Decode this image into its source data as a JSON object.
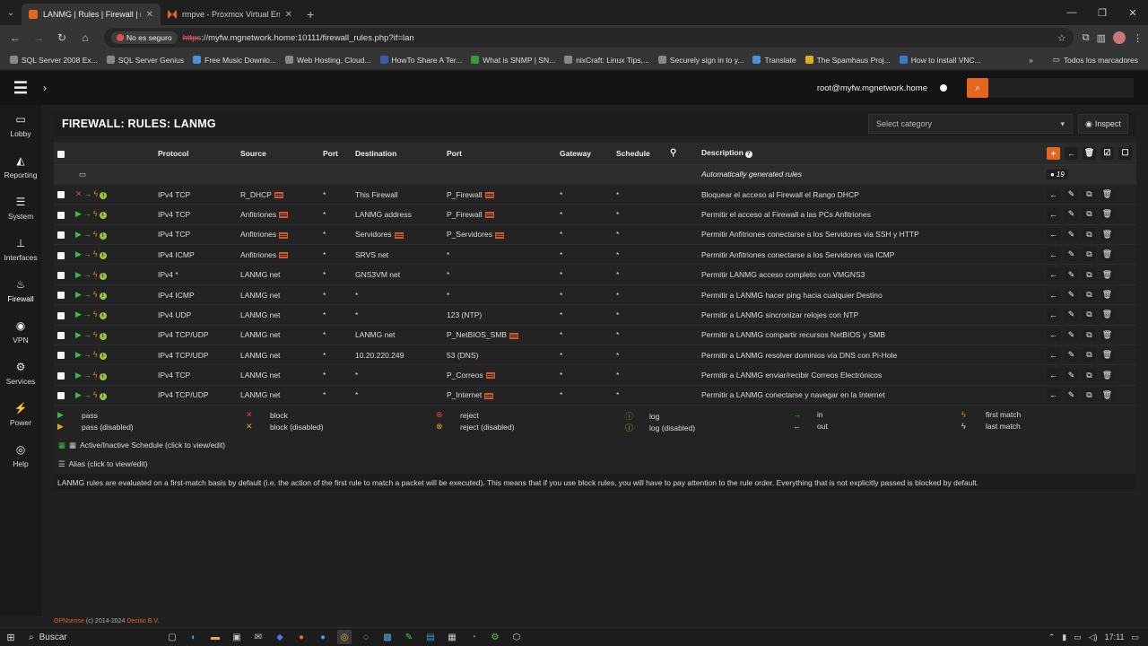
{
  "browser": {
    "tabs": [
      {
        "title": "LANMG | Rules | Firewall | myfw",
        "fav_color": "#e5661c",
        "active": true
      },
      {
        "title": "rmpve - Proxmox Virtual Enviro",
        "fav_color": "#e5661c",
        "active": false
      }
    ],
    "insecure_label": "No es seguro",
    "url_scheme": "https",
    "url_rest": "://myfw.mgnetwork.home:10111/firewall_rules.php?if=lan",
    "bookmarks": [
      "SQL Server 2008 Ex...",
      "SQL Server Genius",
      "Free Music Downlo...",
      "Web Hosting, Cloud...",
      "HowTo Share A Ter...",
      "What is SNMP | SN...",
      "nixCraft: Linux Tips,...",
      "Securely sign in to y...",
      "Translate",
      "The Spamhaus Proj...",
      "How to install VNC..."
    ],
    "all_bookmarks": "Todos los marcadores"
  },
  "header": {
    "user": "root@myfw.mgnetwork.home"
  },
  "nav": [
    {
      "label": "Lobby",
      "icon": "laptop-icon",
      "glyph": "▭"
    },
    {
      "label": "Reporting",
      "icon": "chart-icon",
      "glyph": "◭"
    },
    {
      "label": "System",
      "icon": "server-icon",
      "glyph": "☰"
    },
    {
      "label": "Interfaces",
      "icon": "network-icon",
      "glyph": "⊥"
    },
    {
      "label": "Firewall",
      "icon": "fire-icon",
      "glyph": "♨"
    },
    {
      "label": "VPN",
      "icon": "globe-icon",
      "glyph": "◉"
    },
    {
      "label": "Services",
      "icon": "cog-icon",
      "glyph": "⚙"
    },
    {
      "label": "Power",
      "icon": "plug-icon",
      "glyph": "⚡"
    },
    {
      "label": "Help",
      "icon": "lifebuoy-icon",
      "glyph": "◎"
    }
  ],
  "page": {
    "title": "FIREWALL: RULES: LANMG",
    "category_placeholder": "Select category",
    "inspect_label": "Inspect"
  },
  "table": {
    "headers": {
      "protocol": "Protocol",
      "source": "Source",
      "port": "Port",
      "destination": "Destination",
      "dport": "Port",
      "gateway": "Gateway",
      "schedule": "Schedule",
      "description": "Description"
    },
    "auto_row": {
      "label": "Automatically generated rules",
      "count": "19"
    },
    "rules": [
      {
        "action": "block",
        "protocol": "IPv4 TCP",
        "source": "R_DHCP",
        "source_alias": true,
        "sport": "*",
        "destination": "This Firewall",
        "dest_alias": false,
        "dport": "P_Firewall",
        "dport_alias": true,
        "gateway": "*",
        "schedule": "*",
        "description": "Bloquear el acceso al Firewall el Rango DHCP"
      },
      {
        "action": "pass",
        "protocol": "IPv4 TCP",
        "source": "Anfitriones",
        "source_alias": true,
        "sport": "*",
        "destination": "LANMG address",
        "dest_alias": false,
        "dport": "P_Firewall",
        "dport_alias": true,
        "gateway": "*",
        "schedule": "*",
        "description": "Permitir el acceso al Firewall a las PCs Anfitriones"
      },
      {
        "action": "pass",
        "protocol": "IPv4 TCP",
        "source": "Anfitriones",
        "source_alias": true,
        "sport": "*",
        "destination": "Servidores",
        "dest_alias": true,
        "dport": "P_Servidores",
        "dport_alias": true,
        "gateway": "*",
        "schedule": "*",
        "description": "Permitir Anfitriones conectarse a los Servidores via SSH y HTTP"
      },
      {
        "action": "pass",
        "protocol": "IPv4 ICMP",
        "source": "Anfitriones",
        "source_alias": true,
        "sport": "*",
        "destination": "SRVS net",
        "dest_alias": false,
        "dport": "*",
        "dport_alias": false,
        "gateway": "*",
        "schedule": "*",
        "description": "Permitir Anfitriones conectarse a los Servidores via ICMP"
      },
      {
        "action": "pass",
        "protocol": "IPv4 *",
        "source": "LANMG net",
        "source_alias": false,
        "sport": "*",
        "destination": "GNS3VM net",
        "dest_alias": false,
        "dport": "*",
        "dport_alias": false,
        "gateway": "*",
        "schedule": "*",
        "description": "Permitir LANMG acceso completo con VMGNS3"
      },
      {
        "action": "pass",
        "protocol": "IPv4 ICMP",
        "source": "LANMG net",
        "source_alias": false,
        "sport": "*",
        "destination": "*",
        "dest_alias": false,
        "dport": "*",
        "dport_alias": false,
        "gateway": "*",
        "schedule": "*",
        "description": "Permitir a LANMG hacer ping hacia cualquier Destino"
      },
      {
        "action": "pass",
        "protocol": "IPv4 UDP",
        "source": "LANMG net",
        "source_alias": false,
        "sport": "*",
        "destination": "*",
        "dest_alias": false,
        "dport": "123 (NTP)",
        "dport_alias": false,
        "gateway": "*",
        "schedule": "*",
        "description": "Permitir a LANMG sincronizar relojes con NTP"
      },
      {
        "action": "pass",
        "protocol": "IPv4 TCP/UDP",
        "source": "LANMG net",
        "source_alias": false,
        "sport": "*",
        "destination": "LANMG net",
        "dest_alias": false,
        "dport": "P_NetBIOS_SMB",
        "dport_alias": true,
        "gateway": "*",
        "schedule": "*",
        "description": "Permitir a LANMG compartir recursos NetBIOS y SMB"
      },
      {
        "action": "pass",
        "protocol": "IPv4 TCP/UDP",
        "source": "LANMG net",
        "source_alias": false,
        "sport": "*",
        "destination": "10.20.220.249",
        "dest_alias": false,
        "dport": "53 (DNS)",
        "dport_alias": false,
        "gateway": "*",
        "schedule": "*",
        "description": "Permitir a LANMG resolver dominios vía DNS con Pi-Hole"
      },
      {
        "action": "pass",
        "protocol": "IPv4 TCP",
        "source": "LANMG net",
        "source_alias": false,
        "sport": "*",
        "destination": "*",
        "dest_alias": false,
        "dport": "P_Correos",
        "dport_alias": true,
        "gateway": "*",
        "schedule": "*",
        "description": "Permitir a LANMG enviar/recibir Correos Electrónicos"
      },
      {
        "action": "pass",
        "protocol": "IPv4 TCP/UDP",
        "source": "LANMG net",
        "source_alias": false,
        "sport": "*",
        "destination": "*",
        "dest_alias": false,
        "dport": "P_Internet",
        "dport_alias": true,
        "gateway": "*",
        "schedule": "*",
        "description": "Permitir a LANMG conectarse y navegar en la Internet"
      }
    ]
  },
  "legend": {
    "pass": "pass",
    "pass_disabled": "pass (disabled)",
    "block": "block",
    "block_disabled": "block (disabled)",
    "reject": "reject",
    "reject_disabled": "reject (disabled)",
    "log": "log",
    "log_disabled": "log (disabled)",
    "in": "in",
    "out": "out",
    "first_match": "first match",
    "last_match": "last match"
  },
  "footer": {
    "schedule_link": "Active/Inactive Schedule (click to view/edit)",
    "alias_link": "Alias (click to view/edit)",
    "note": "LANMG rules are evaluated on a first-match basis by default (i.e. the action of the first rule to match a packet will be executed). This means that if you use block rules, you will have to pay attention to the rule order. Everything that is not explicitly passed is blocked by default.",
    "brand": "OPNsense",
    "copyright": "(c) 2014-2024",
    "company": "Deciso B.V."
  },
  "taskbar": {
    "search": "Buscar",
    "time": "17:11"
  },
  "colors": {
    "accent": "#e5661c",
    "pass": "#3fbb3f",
    "block": "#e04040"
  }
}
